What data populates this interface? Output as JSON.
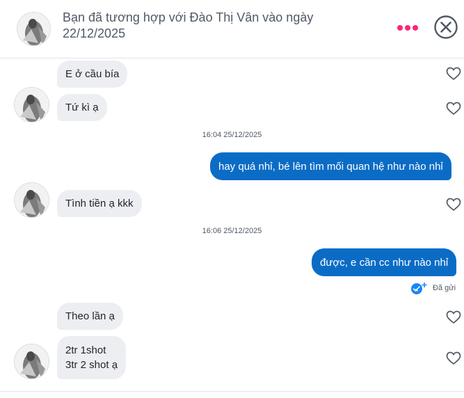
{
  "header": {
    "title": "Bạn đã tương hợp với Đào Thị Vân vào ngày 22/12/2025"
  },
  "colors": {
    "accent_pink": "#fd267a",
    "outgoing_bubble": "#0b6cc6",
    "incoming_bubble": "#eceef2",
    "read_check": "#1786f8"
  },
  "messages": {
    "m1": "E ở cầu bía",
    "m2": "Tứ kì ạ",
    "t1": "16:04 25/12/2025",
    "m3": "hay quá nhỉ, bé lên tìm mối quan hệ như nào nhỉ",
    "m4": "Tình tiền ạ kkk",
    "t2": "16:06 25/12/2025",
    "m5": "được, e cần cc như nào nhỉ",
    "m6": "Theo lần ạ",
    "m7_line1": "2tr 1shot",
    "m7_line2": "3tr 2 shot ạ"
  },
  "status": {
    "sent_label": "Đã gửi"
  },
  "icons": {
    "more": "more-dots-icon",
    "close": "close-circle-icon",
    "like": "heart-icon",
    "sent": "sent-check-icon"
  }
}
